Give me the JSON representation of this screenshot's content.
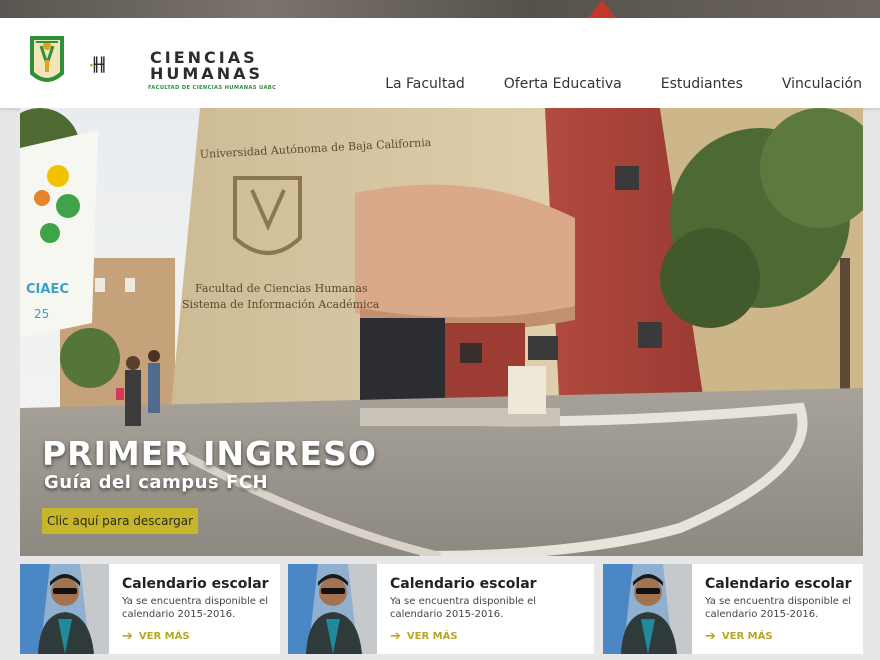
{
  "brand": {
    "name_line1": "CIENCIAS",
    "name_line2": "HUMANAS",
    "subtitle": "FACULTAD DE CIENCIAS HUMANAS UABC"
  },
  "nav": {
    "items": [
      "La Facultad",
      "Oferta Educativa",
      "Estudiantes",
      "Vinculación"
    ]
  },
  "hero": {
    "title": "PRIMER INGRESO",
    "subtitle": "Guía del campus FCH",
    "button": "Clic aquí para descargar",
    "sign_top": "Universidad Autónoma de Baja California",
    "sign_main1": "Facultad de Ciencias Humanas",
    "sign_main2": "Sistema de Información Académica",
    "banner_text": "CIAEC",
    "banner_number": "25"
  },
  "cards": [
    {
      "title": "Calendario escolar",
      "text": "Ya se encuentra disponible el calendario 2015-2016.",
      "more": "VER MÁS"
    },
    {
      "title": "Calendario escolar",
      "text": "Ya se encuentra disponible el calendario 2015-2016.",
      "more": "VER MÁS"
    },
    {
      "title": "Calendario escolar",
      "text": "Ya se encuentra disponible el calendario 2015-2016.",
      "more": "VER MÁS"
    }
  ],
  "colors": {
    "accent": "#c8b62a",
    "brand_green": "#2f8f3a",
    "building_red": "#a8423a",
    "building_tan": "#d8c9a8"
  }
}
